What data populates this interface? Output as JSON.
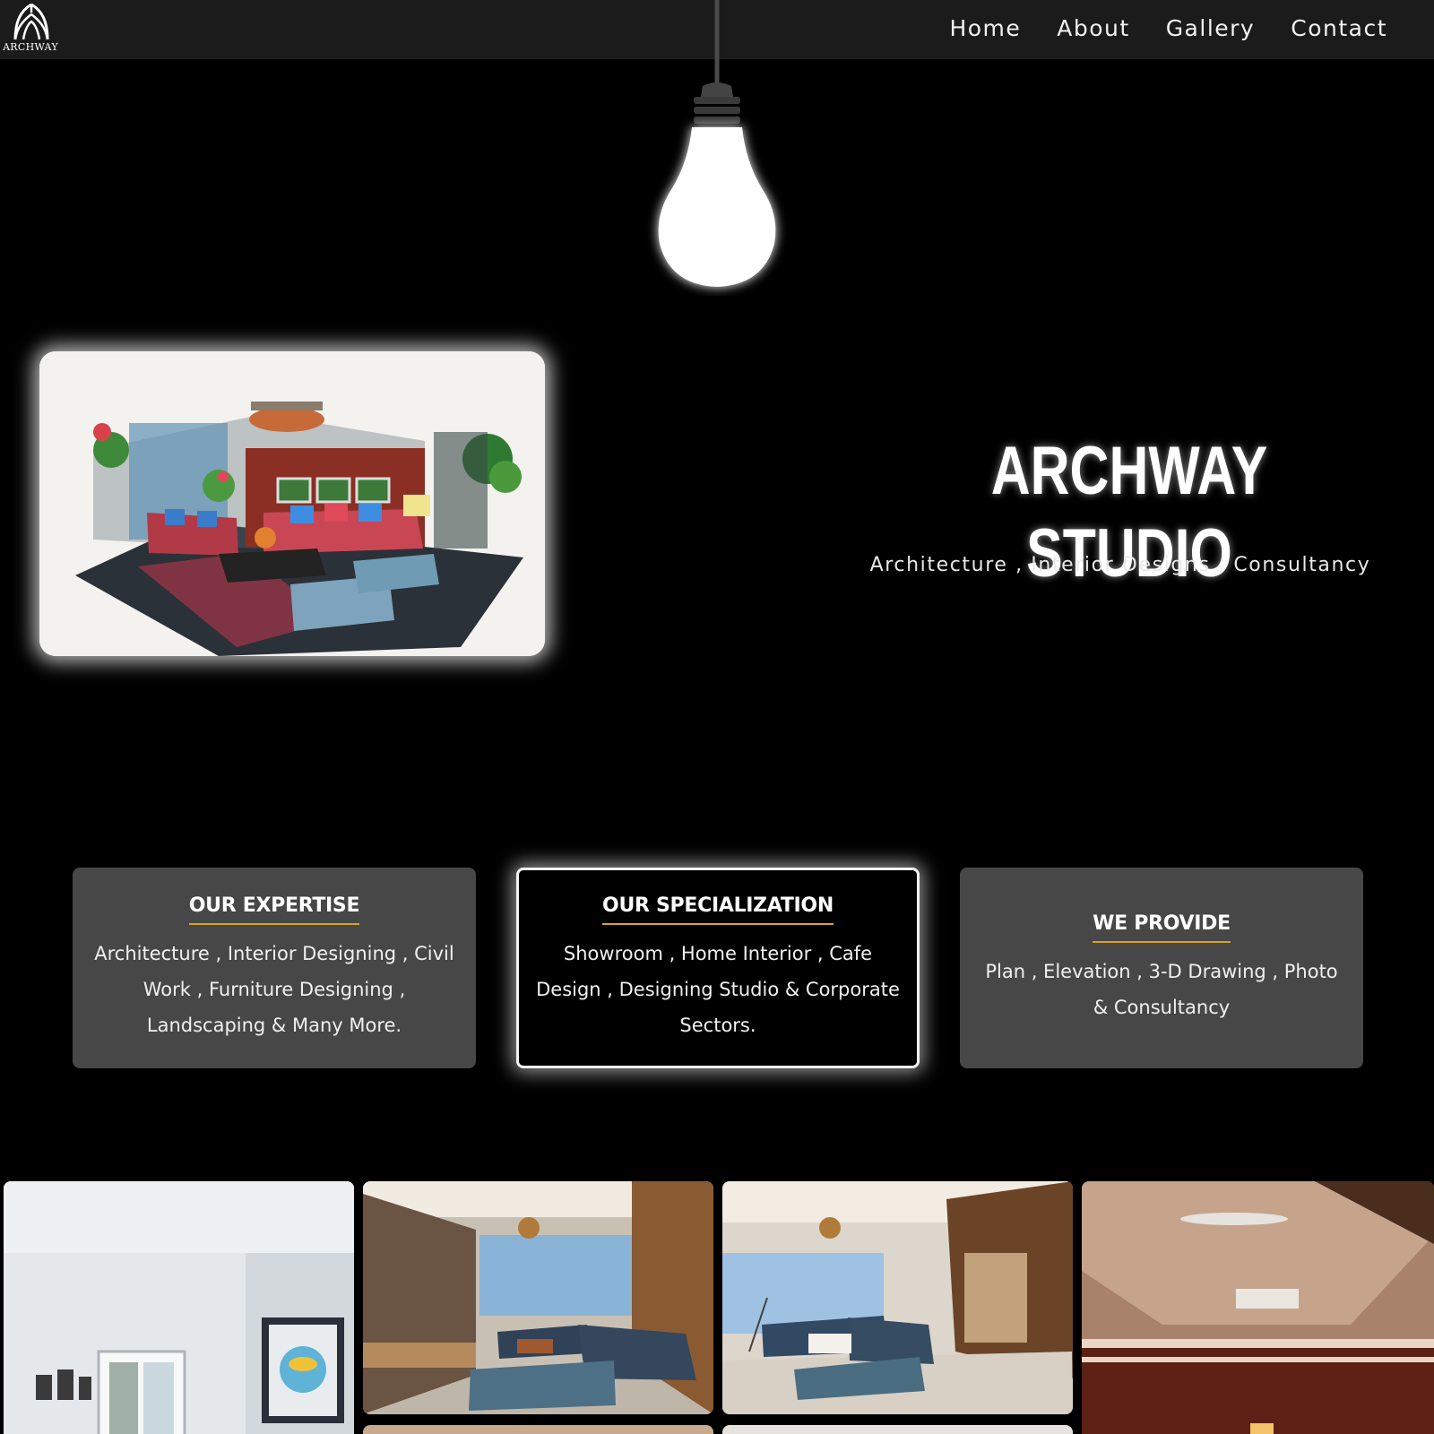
{
  "brand": {
    "logo_text": "ARCHWAY",
    "logo_icon": "archway-logo-icon"
  },
  "nav": {
    "items": [
      {
        "label": "Home"
      },
      {
        "label": "About"
      },
      {
        "label": "Gallery"
      },
      {
        "label": "Contact"
      }
    ]
  },
  "hero": {
    "title": "ARCHWAY STUDIO",
    "subtitle": "Architecture , Interior Designs , Consultancy",
    "image": "interior-sketch-image",
    "decor": "hanging-light-bulb"
  },
  "cards": [
    {
      "heading": "OUR EXPERTISE",
      "text": "Architecture , Interior Designing , Civil Work , Furniture Designing , Landscaping & Many More."
    },
    {
      "heading": "OUR SPECIALIZATION",
      "text": "Showroom , Home Interior , Cafe Design , Designing Studio & Corporate Sectors."
    },
    {
      "heading": "WE PROVIDE",
      "text": "Plan , Elevation , 3-D Drawing , Photo & Consultancy"
    }
  ],
  "gallery": {
    "items": [
      "white-room-photo",
      "living-room-photo-1",
      "living-room-photo-2",
      "ceiling-room-photo",
      "partial-photo-5",
      "partial-photo-6"
    ]
  },
  "colors": {
    "background": "#000000",
    "navbar": "#1b1b1b",
    "card": "#474747",
    "accent_underline": "#d8a418"
  }
}
